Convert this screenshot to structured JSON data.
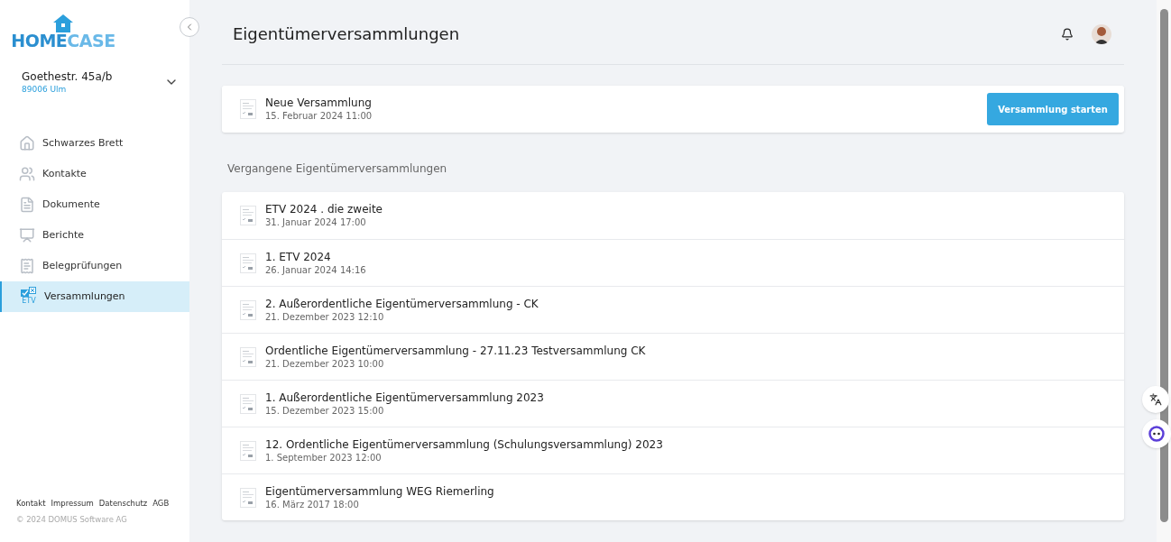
{
  "logo": {
    "part_1": "HOME",
    "part_2": "CASE"
  },
  "property": {
    "street": "Goethestr. 45a/b",
    "city": "89006 Ulm"
  },
  "nav": [
    {
      "label": "Schwarzes Brett",
      "kind": "home",
      "selected": false
    },
    {
      "label": "Kontakte",
      "kind": "contacts",
      "selected": false
    },
    {
      "label": "Dokumente",
      "kind": "document",
      "selected": false
    },
    {
      "label": "Berichte",
      "kind": "chart",
      "selected": false
    },
    {
      "label": "Belegprüfungen",
      "kind": "receipt",
      "selected": false
    },
    {
      "label": "Versammlungen",
      "kind": "etv",
      "icon_text": "ETV",
      "selected": true
    }
  ],
  "footer": {
    "links": [
      "Kontakt",
      "Impressum",
      "Datenschutz",
      "AGB"
    ],
    "copyright": "© 2024 DOMUS Software AG"
  },
  "page_title": "Eigentümerversammlungen",
  "upcoming": {
    "title": "Neue Versammlung",
    "date": "15. Februar 2024 11:00",
    "button": "Versammlung starten"
  },
  "past_heading": "Vergangene Eigentümerversammlungen",
  "past": [
    {
      "title": "ETV 2024 . die zweite",
      "date": "31. Januar 2024 17:00"
    },
    {
      "title": "1. ETV 2024",
      "date": "26. Januar 2024 14:16"
    },
    {
      "title": "2. Außerordentliche Eigentümerversammlung - CK",
      "date": "21. Dezember 2023 12:10"
    },
    {
      "title": "Ordentliche Eigentümerversammlung - 27.11.23 Testversammlung CK",
      "date": "21. Dezember 2023 10:00"
    },
    {
      "title": "1. Außerordentliche Eigentümerversammlung 2023",
      "date": "15. Dezember 2023 15:00"
    },
    {
      "title": "12. Ordentliche Eigentümerversammlung (Schulungsversammlung) 2023",
      "date": "1. September 2023 12:00"
    },
    {
      "title": "Eigentümerversammlung WEG Riemerling",
      "date": "16. März 2017 18:00"
    }
  ]
}
